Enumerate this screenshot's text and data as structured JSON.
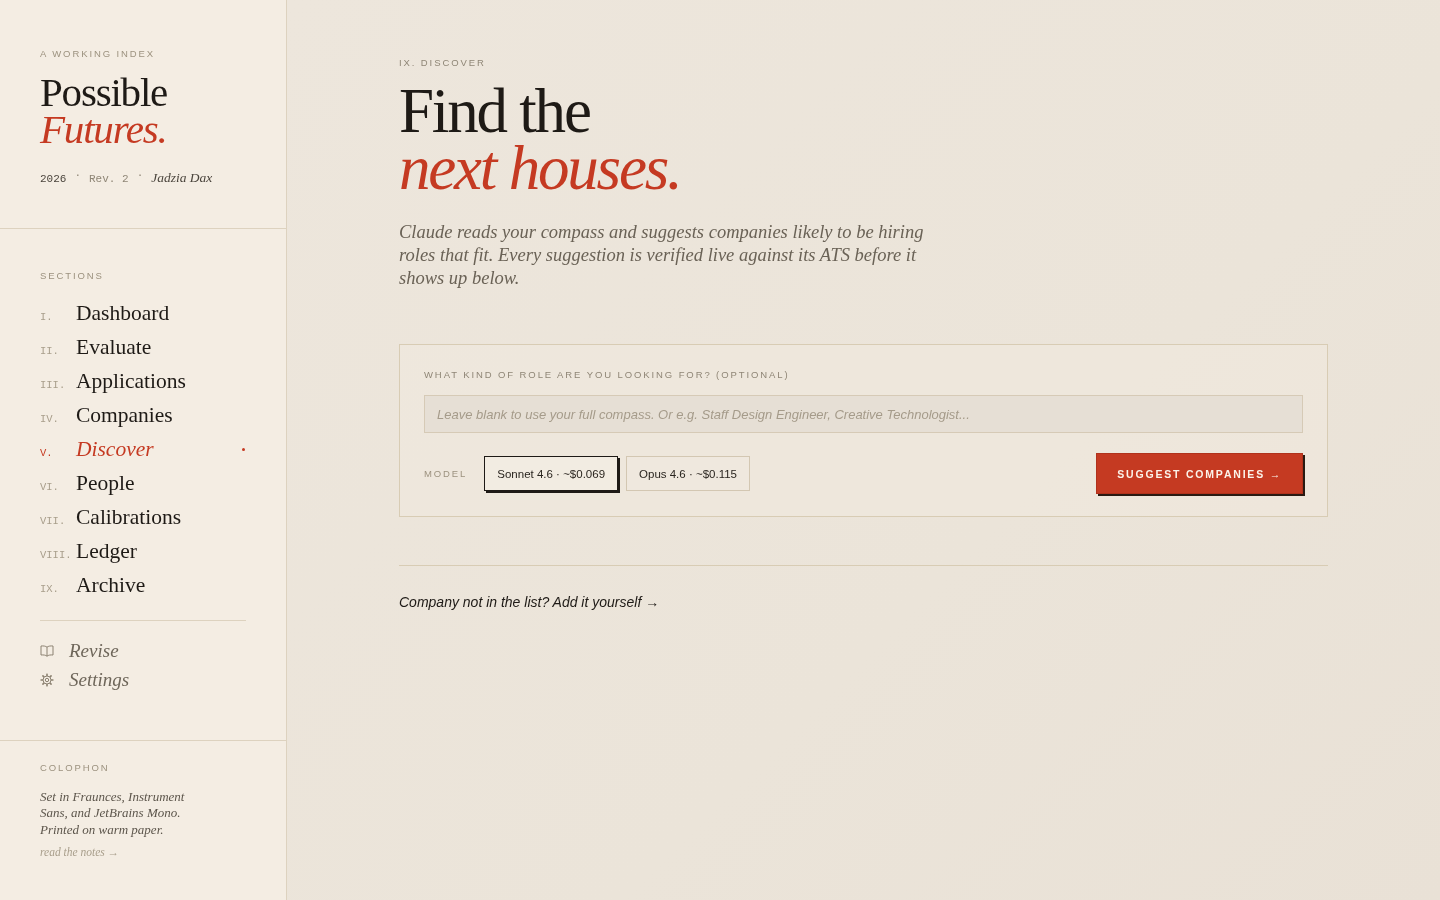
{
  "sidebar": {
    "eyebrow": "A WORKING INDEX",
    "title": "Possible",
    "title_accent": "Futures.",
    "meta": [
      {
        "text": "2026",
        "kind": "strong"
      },
      {
        "text": "·",
        "kind": "dot"
      },
      {
        "text": "Rev. 2",
        "kind": "muted"
      },
      {
        "text": "·",
        "kind": "dot"
      },
      {
        "text": "Jadzia Dax",
        "kind": "signature"
      }
    ],
    "sections": {
      "label": "SECTIONS",
      "items": [
        {
          "numeral": "I.",
          "label": "Dashboard",
          "selected": false
        },
        {
          "numeral": "II.",
          "label": "Evaluate",
          "selected": false
        },
        {
          "numeral": "III.",
          "label": "Applications",
          "selected": false
        },
        {
          "numeral": "IV.",
          "label": "Companies",
          "selected": false
        },
        {
          "numeral": "V.",
          "label": "Discover",
          "selected": true
        },
        {
          "numeral": "VI.",
          "label": "People",
          "selected": false
        },
        {
          "numeral": "VII.",
          "label": "Calibrations",
          "selected": false
        },
        {
          "numeral": "VIII.",
          "label": "Ledger",
          "selected": false
        },
        {
          "numeral": "IX.",
          "label": "Archive",
          "selected": false
        }
      ]
    },
    "links": [
      {
        "label": "Revise",
        "kind": "revise"
      },
      {
        "label": "Settings",
        "kind": "settings"
      }
    ],
    "colophon": {
      "label": "COLOPHON",
      "text": "Set in Fraunces, Instrument Sans, and JetBrains Mono. Printed on warm paper.",
      "link": "read the notes →"
    }
  },
  "main": {
    "eyebrow": "IX. DISCOVER",
    "title": "Find the",
    "title_accent": "next houses.",
    "intro": "Claude reads your compass and suggests companies likely to be hiring roles that fit. Every suggestion is verified live against its ATS before it shows up below.",
    "form": {
      "label": "WHAT KIND OF ROLE ARE YOU LOOKING FOR? (OPTIONAL)",
      "placeholder": "Leave blank to use your full compass. Or e.g. Staff Design Engineer, Creative Technologist...",
      "model_label": "MODEL",
      "models": [
        {
          "label": "Sonnet 4.6 · ~$0.069",
          "selected": true
        },
        {
          "label": "Opus 4.6 · ~$0.115",
          "selected": false
        }
      ],
      "submit": "SUGGEST COMPANIES →"
    },
    "add_link": "Company not in the list? Add it yourself →"
  }
}
